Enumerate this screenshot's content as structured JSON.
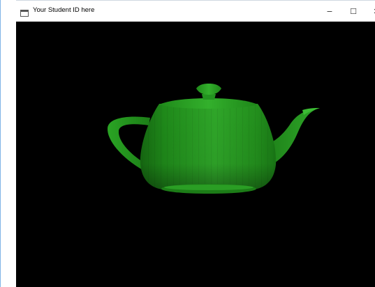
{
  "window": {
    "title": "Your Student ID here",
    "controls": {
      "minimize_glyph": "−",
      "maximize_glyph": "☐",
      "close_glyph": "✕"
    }
  },
  "scene": {
    "object": "teapot",
    "background_color": "#000000",
    "object_color": "#2a9a22"
  },
  "icons": {
    "app_icon": "window-app-icon",
    "minimize": "minimize-icon",
    "maximize": "maximize-icon",
    "close": "close-icon"
  }
}
